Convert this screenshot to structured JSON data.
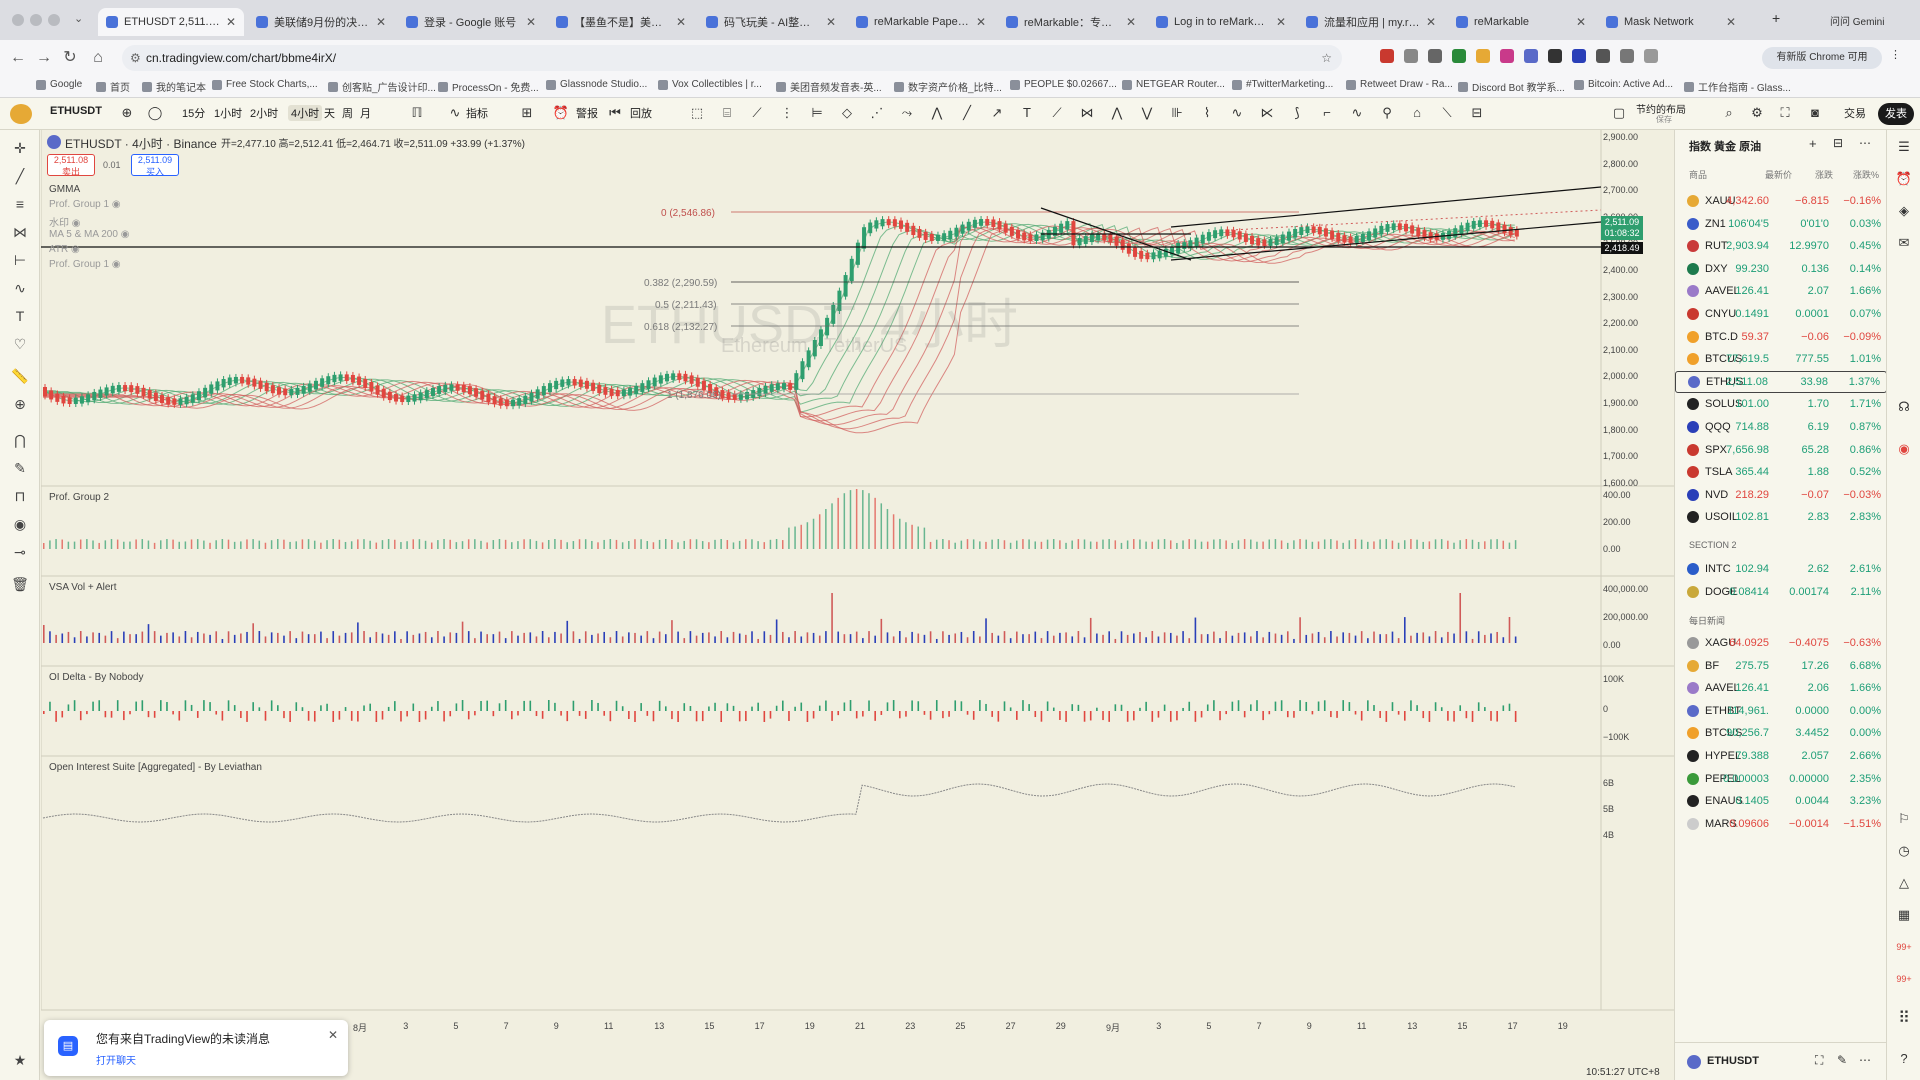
{
  "browser": {
    "tabs": [
      {
        "title": "ETHUSDT 2,511.08 ▲ ·",
        "active": true
      },
      {
        "title": "美联储9月份的决定? 全",
        "active": false
      },
      {
        "title": "登录 - Google 账号",
        "active": false
      },
      {
        "title": "【墨鱼不是】美股开美股",
        "active": false
      },
      {
        "title": "码飞玩美 - AI整理会议纪",
        "active": false
      },
      {
        "title": "reMarkable Paper Pure",
        "active": false
      },
      {
        "title": "reMarkable：专注工作",
        "active": false
      },
      {
        "title": "Log in to reMarkable",
        "active": false
      },
      {
        "title": "流量和应用 | my.reMark",
        "active": false
      },
      {
        "title": "reMarkable",
        "active": false
      },
      {
        "title": "Mask Network",
        "active": false
      }
    ],
    "new_tab": "+",
    "profile_right": "问问 Gemini",
    "url": "cn.tradingview.com/chart/bbme4irX/",
    "chrome_badge": "有新版 Chrome 可用",
    "bookmarks": [
      "Google",
      "首页",
      "我的笔记本",
      "Free Stock Charts,...",
      "创客贴_广告设计印...",
      "ProcessOn - 免费...",
      "Glassnode Studio...",
      "Vox Collectibles | r...",
      "美团音频发音表-英...",
      "数字资产价格_比特...",
      "PEOPLE $0.02667...",
      "NETGEAR Router...",
      "#TwitterMarketing...",
      "Retweet Draw - Ra...",
      "Discord Bot 教学系...",
      "Bitcoin: Active Ad...",
      "工作台指南 - Glass..."
    ]
  },
  "toolbar": {
    "symbol": "ETHUSDT",
    "intervals": [
      "15分",
      "1小时",
      "2小时",
      "4小时",
      "天",
      "周",
      "月"
    ],
    "indicators_label": "指标",
    "alert_label": "警报",
    "replay_label": "回放",
    "layout_label": "节约的布局",
    "layout_sub": "保存",
    "trade_label": "交易",
    "publish_label": "发表"
  },
  "legend": {
    "title": "ETHUSDT · 4小时 · Binance",
    "ohlc": "开=2,477.10 高=2,512.41 低=2,464.71 收=2,511.09 +33.99 (+1.37%)",
    "sell_price": "2,511.08",
    "sell_label": "卖出",
    "spread": "0.01",
    "buy_price": "2,511.09",
    "buy_label": "买入",
    "indicators": [
      "GMMA",
      "Prof. Group 1",
      "水印",
      "MA 5 & MA 200",
      "ATR",
      "Prof. Group 1"
    ]
  },
  "watermark": {
    "main": "ETHUSDT, 4小时",
    "sub": "Ethereum / TetherUS"
  },
  "fib": [
    {
      "label": "0 (2,546.86)"
    },
    {
      "label": "0.382 (2,290.59)"
    },
    {
      "label": "0.5 (2,211.43)"
    },
    {
      "label": "0.618 (2,132.27)"
    },
    {
      "label": "1 (1,876.06)"
    }
  ],
  "price_axis": [
    "2,900.00",
    "2,800.00",
    "2,700.00",
    "2,600.00",
    "2,500.00",
    "2,400.00",
    "2,300.00",
    "2,200.00",
    "2,100.00",
    "2,000.00",
    "1,900.00",
    "1,800.00",
    "1,700.00",
    "1,600.00"
  ],
  "price_tag": {
    "value": "2,511.09",
    "countdown": "01:08:32"
  },
  "line_tag": "2,418.49",
  "panes": [
    {
      "title": "Prof. Group 2",
      "axis": [
        "400.00",
        "200.00",
        "0.00"
      ]
    },
    {
      "title": "VSA Vol + Alert",
      "axis": [
        "400,000.00",
        "200,000.00",
        "0.00"
      ]
    },
    {
      "title": "OI Delta - By Nobody",
      "axis": [
        "100K",
        "0",
        "−100K"
      ]
    },
    {
      "title": "Open Interest Suite [Aggregated] - By Leviathan",
      "axis": [
        "6B",
        "5B",
        "4B"
      ]
    }
  ],
  "time_axis": [
    "8月",
    "3",
    "5",
    "7",
    "9",
    "11",
    "13",
    "15",
    "17",
    "19",
    "21",
    "23",
    "25",
    "27",
    "29",
    "9月",
    "3",
    "5",
    "7",
    "9",
    "11",
    "13",
    "15",
    "17",
    "19"
  ],
  "clock": "10:51:27 UTC+8",
  "watchlist": {
    "title": "指数 黄金 原油",
    "headers": [
      "商品",
      "最新价",
      "涨跌",
      "涨跌%"
    ],
    "rows": [
      {
        "sym": "XAUU",
        "last": "4,342.60",
        "chg": "−6.815",
        "pct": "−0.16%",
        "dir": "neg",
        "color": "#e6a935"
      },
      {
        "sym": "ZN1",
        "last": "106'04'5",
        "chg": "0'01'0",
        "pct": "0.03%",
        "dir": "pos",
        "color": "#3a5cc9"
      },
      {
        "sym": "RUT",
        "last": "2,903.94",
        "chg": "12.9970",
        "pct": "0.45%",
        "dir": "pos",
        "color": "#c93a3a"
      },
      {
        "sym": "DXY",
        "last": "99.230",
        "chg": "0.136",
        "pct": "0.14%",
        "dir": "pos",
        "color": "#1d7a4d"
      },
      {
        "sym": "AAVEL",
        "last": "126.41",
        "chg": "2.07",
        "pct": "1.66%",
        "dir": "pos",
        "color": "#9a7ac8"
      },
      {
        "sym": "CNYU",
        "last": "0.1491",
        "chg": "0.0001",
        "pct": "0.07%",
        "dir": "pos",
        "color": "#c9392f"
      },
      {
        "sym": "BTC.D",
        "last": "59.37",
        "chg": "−0.06",
        "pct": "−0.09%",
        "dir": "neg",
        "color": "#f0a02a"
      },
      {
        "sym": "BTCUS",
        "last": "77,619.5",
        "chg": "777.55",
        "pct": "1.01%",
        "dir": "pos",
        "color": "#f0a02a"
      },
      {
        "sym": "ETHUS",
        "last": "2,511.08",
        "chg": "33.98",
        "pct": "1.37%",
        "dir": "pos",
        "color": "#5a6ac8"
      },
      {
        "sym": "SOLUS",
        "last": "101.00",
        "chg": "1.70",
        "pct": "1.71%",
        "dir": "pos",
        "color": "#222222"
      },
      {
        "sym": "QQQ",
        "last": "714.88",
        "chg": "6.19",
        "pct": "0.87%",
        "dir": "pos",
        "color": "#2a3fb8"
      },
      {
        "sym": "SPX",
        "last": "7,656.98",
        "chg": "65.28",
        "pct": "0.86%",
        "dir": "pos",
        "color": "#c9392f"
      },
      {
        "sym": "TSLA",
        "last": "365.44",
        "chg": "1.88",
        "pct": "0.52%",
        "dir": "pos",
        "color": "#c9392f"
      },
      {
        "sym": "NVD",
        "last": "218.29",
        "chg": "−0.07",
        "pct": "−0.03%",
        "dir": "neg",
        "color": "#2a3fb8"
      },
      {
        "sym": "USOIL",
        "last": "102.81",
        "chg": "2.83",
        "pct": "2.83%",
        "dir": "pos",
        "color": "#222222"
      }
    ],
    "section2": "SECTION 2",
    "rows2": [
      {
        "sym": "INTC",
        "last": "102.94",
        "chg": "2.62",
        "pct": "2.61%",
        "dir": "pos",
        "color": "#2a5cc9"
      },
      {
        "sym": "DOGE",
        "last": "0.08414",
        "chg": "0.00174",
        "pct": "2.11%",
        "dir": "pos",
        "color": "#c9a83a"
      }
    ],
    "section3": "每日新闻",
    "rows3": [
      {
        "sym": "XAGU",
        "last": "64.0925",
        "chg": "−0.4075",
        "pct": "−0.63%",
        "dir": "neg",
        "color": "#999999"
      },
      {
        "sym": "BF",
        "last": "275.75",
        "chg": "17.26",
        "pct": "6.68%",
        "dir": "pos",
        "color": "#e6a935"
      },
      {
        "sym": "AAVEL",
        "last": "126.41",
        "chg": "2.06",
        "pct": "1.66%",
        "dir": "pos",
        "color": "#9a7ac8"
      },
      {
        "sym": "ETHBT",
        "last": "114,961.",
        "chg": "0.0000",
        "pct": "0.00%",
        "dir": "pos",
        "color": "#5a6ac8"
      },
      {
        "sym": "BTCUS",
        "last": "90,256.7",
        "chg": "3.4452",
        "pct": "0.00%",
        "dir": "pos",
        "color": "#f0a02a"
      },
      {
        "sym": "HYPEL",
        "last": "79.388",
        "chg": "2.057",
        "pct": "2.66%",
        "dir": "pos",
        "color": "#222222"
      },
      {
        "sym": "PEPEL",
        "last": "0.000003",
        "chg": "0.00000",
        "pct": "2.35%",
        "dir": "pos",
        "color": "#3a9a3a"
      },
      {
        "sym": "ENAUS",
        "last": "0.1405",
        "chg": "0.0044",
        "pct": "3.23%",
        "dir": "pos",
        "color": "#222222"
      },
      {
        "sym": "MARS",
        "last": "0.09606",
        "chg": "−0.0014",
        "pct": "−1.51%",
        "dir": "neg",
        "color": "#cccccc"
      }
    ],
    "footer_symbol": "ETHUSDT"
  },
  "notification": {
    "message": "您有来自TradingView的未读消息",
    "action": "打开聊天"
  },
  "colors": {
    "bg": "#f1efe0",
    "up": "#2e9e6e",
    "down": "#e0463f",
    "accent": "#2962ff"
  }
}
